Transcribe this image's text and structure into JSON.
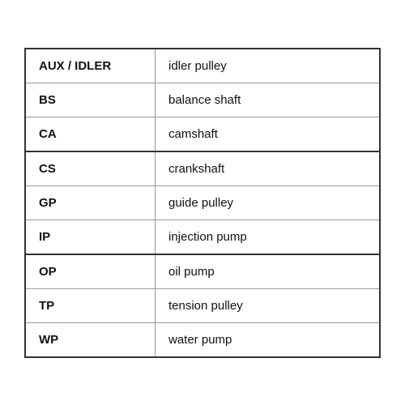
{
  "table": {
    "rows": [
      {
        "abbr": "AUX / IDLER",
        "desc": "idler pulley",
        "thickBottom": false
      },
      {
        "abbr": "BS",
        "desc": "balance shaft",
        "thickBottom": false
      },
      {
        "abbr": "CA",
        "desc": "camshaft",
        "thickBottom": true
      },
      {
        "abbr": "CS",
        "desc": "crankshaft",
        "thickBottom": false
      },
      {
        "abbr": "GP",
        "desc": "guide pulley",
        "thickBottom": false
      },
      {
        "abbr": "IP",
        "desc": "injection pump",
        "thickBottom": true
      },
      {
        "abbr": "OP",
        "desc": "oil pump",
        "thickBottom": false
      },
      {
        "abbr": "TP",
        "desc": "tension pulley",
        "thickBottom": false
      },
      {
        "abbr": "WP",
        "desc": "water pump",
        "thickBottom": false
      }
    ]
  }
}
